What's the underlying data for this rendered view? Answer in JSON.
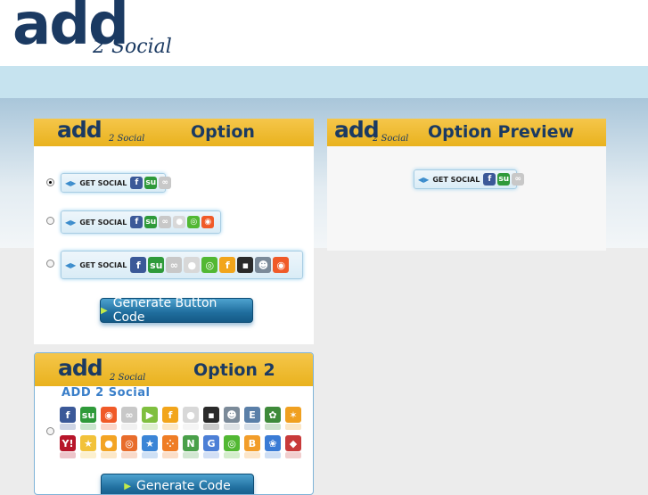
{
  "header": {
    "logo_main": "add",
    "logo_sub": "2 Social"
  },
  "panel_option": {
    "logo": "add",
    "logo_sub": "2 Social",
    "title": "Option",
    "rows": [
      {
        "selected": true,
        "label": "GET SOCIAL",
        "icons": [
          "facebook-icon",
          "stumbleupon-icon",
          "myspace-icon"
        ]
      },
      {
        "selected": false,
        "label": "GET SOCIAL",
        "icons": [
          "facebook-icon",
          "stumbleupon-icon",
          "myspace-icon",
          "reddit-icon",
          "chat-icon",
          "target-icon"
        ]
      },
      {
        "selected": false,
        "label": "GET SOCIAL",
        "icons": [
          "facebook-icon",
          "stumbleupon-icon",
          "myspace-icon",
          "reddit-icon",
          "chat-icon",
          "friendfeed-icon",
          "delicious-icon",
          "person-icon",
          "target-icon"
        ]
      }
    ],
    "button_label": "Generate Button Code"
  },
  "panel_preview": {
    "logo": "add",
    "logo_sub": "2 Social",
    "title": "Option Preview",
    "preview_label": "GET SOCIAL",
    "preview_icons": [
      "facebook-icon",
      "stumbleupon-icon",
      "myspace-icon"
    ]
  },
  "panel_option2": {
    "logo": "add",
    "logo_sub": "2 Social",
    "title": "Option 2",
    "subtitle": "ADD 2 Social",
    "button_label": "Generate Code",
    "icons_row1": [
      "facebook-icon",
      "stumbleupon-icon",
      "target-icon",
      "myspace-icon",
      "play-icon",
      "friendfeed-icon",
      "reddit-icon",
      "delicious-icon",
      "person-icon",
      "e-icon",
      "leaf-icon",
      "satellite-icon"
    ],
    "icons_row2": [
      "yahoo-icon",
      "star-icon",
      "circle-icon",
      "ring-icon",
      "blue-star-icon",
      "dots-icon",
      "n-icon",
      "g-icon",
      "chat-icon",
      "b-icon",
      "flower-icon",
      "diamond-icon"
    ]
  },
  "icon_styles": {
    "facebook-icon": {
      "glyph": "f",
      "color": "#3b5998"
    },
    "stumbleupon-icon": {
      "glyph": "su",
      "color": "#2f9a3a"
    },
    "myspace-icon": {
      "glyph": "∞",
      "color": "#c8c8c8"
    },
    "reddit-icon": {
      "glyph": "●",
      "color": "#d8d8d8"
    },
    "chat-icon": {
      "glyph": "◎",
      "color": "#52b833"
    },
    "target-icon": {
      "glyph": "◉",
      "color": "#f05a28"
    },
    "friendfeed-icon": {
      "glyph": "f",
      "color": "#f2a51b"
    },
    "delicious-icon": {
      "glyph": "▪",
      "color": "#2a2a2a"
    },
    "person-icon": {
      "glyph": "☻",
      "color": "#7b8a99"
    },
    "play-icon": {
      "glyph": "▶",
      "color": "#7fbf3f"
    },
    "e-icon": {
      "glyph": "E",
      "color": "#5a7fa8"
    },
    "leaf-icon": {
      "glyph": "✿",
      "color": "#3e8a3a"
    },
    "satellite-icon": {
      "glyph": "✶",
      "color": "#f0a020"
    },
    "yahoo-icon": {
      "glyph": "Y!",
      "color": "#b7152a"
    },
    "star-icon": {
      "glyph": "★",
      "color": "#f2c23a"
    },
    "circle-icon": {
      "glyph": "●",
      "color": "#f3a423"
    },
    "ring-icon": {
      "glyph": "◎",
      "color": "#e86c2b"
    },
    "blue-star-icon": {
      "glyph": "★",
      "color": "#3b85d6"
    },
    "dots-icon": {
      "glyph": "⁘",
      "color": "#ef7d25"
    },
    "n-icon": {
      "glyph": "N",
      "color": "#4aa04a"
    },
    "g-icon": {
      "glyph": "G",
      "color": "#4c7fd6"
    },
    "b-icon": {
      "glyph": "B",
      "color": "#f29d2a"
    },
    "flower-icon": {
      "glyph": "❀",
      "color": "#3a7bd5"
    },
    "diamond-icon": {
      "glyph": "◆",
      "color": "#c83a3a"
    }
  }
}
